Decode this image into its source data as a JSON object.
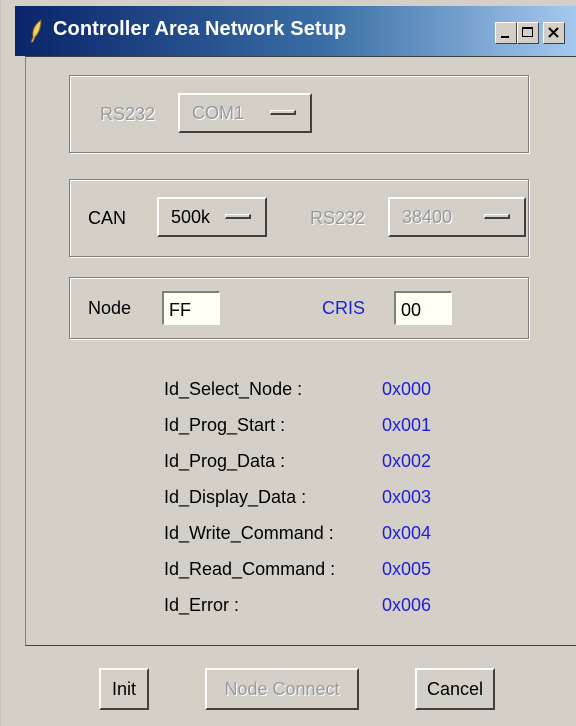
{
  "window": {
    "title": "Controller Area Network Setup"
  },
  "rs232_group": {
    "label": "RS232",
    "port_value": "COM1"
  },
  "can_group": {
    "can_label": "CAN",
    "can_rate": "500k",
    "rs232_label": "RS232",
    "rs232_rate": "38400"
  },
  "node_group": {
    "node_label": "Node",
    "node_value": "FF",
    "cris_label": "CRIS",
    "cris_value": "00"
  },
  "ids": [
    {
      "label": "Id_Select_Node :",
      "value": "0x000"
    },
    {
      "label": "Id_Prog_Start :",
      "value": "0x001"
    },
    {
      "label": "Id_Prog_Data :",
      "value": "0x002"
    },
    {
      "label": "Id_Display_Data :",
      "value": "0x003"
    },
    {
      "label": "Id_Write_Command :",
      "value": "0x004"
    },
    {
      "label": "Id_Read_Command :",
      "value": "0x005"
    },
    {
      "label": "Id_Error :",
      "value": "0x006"
    }
  ],
  "buttons": {
    "init": "Init",
    "node_connect": "Node Connect",
    "cancel": "Cancel"
  },
  "colors": {
    "title_gradient_start": "#0a246a",
    "title_gradient_end": "#a6caf0",
    "face": "#d4d0c8",
    "value_blue": "#1f1fd8",
    "disabled_text": "#9a9a9a"
  }
}
